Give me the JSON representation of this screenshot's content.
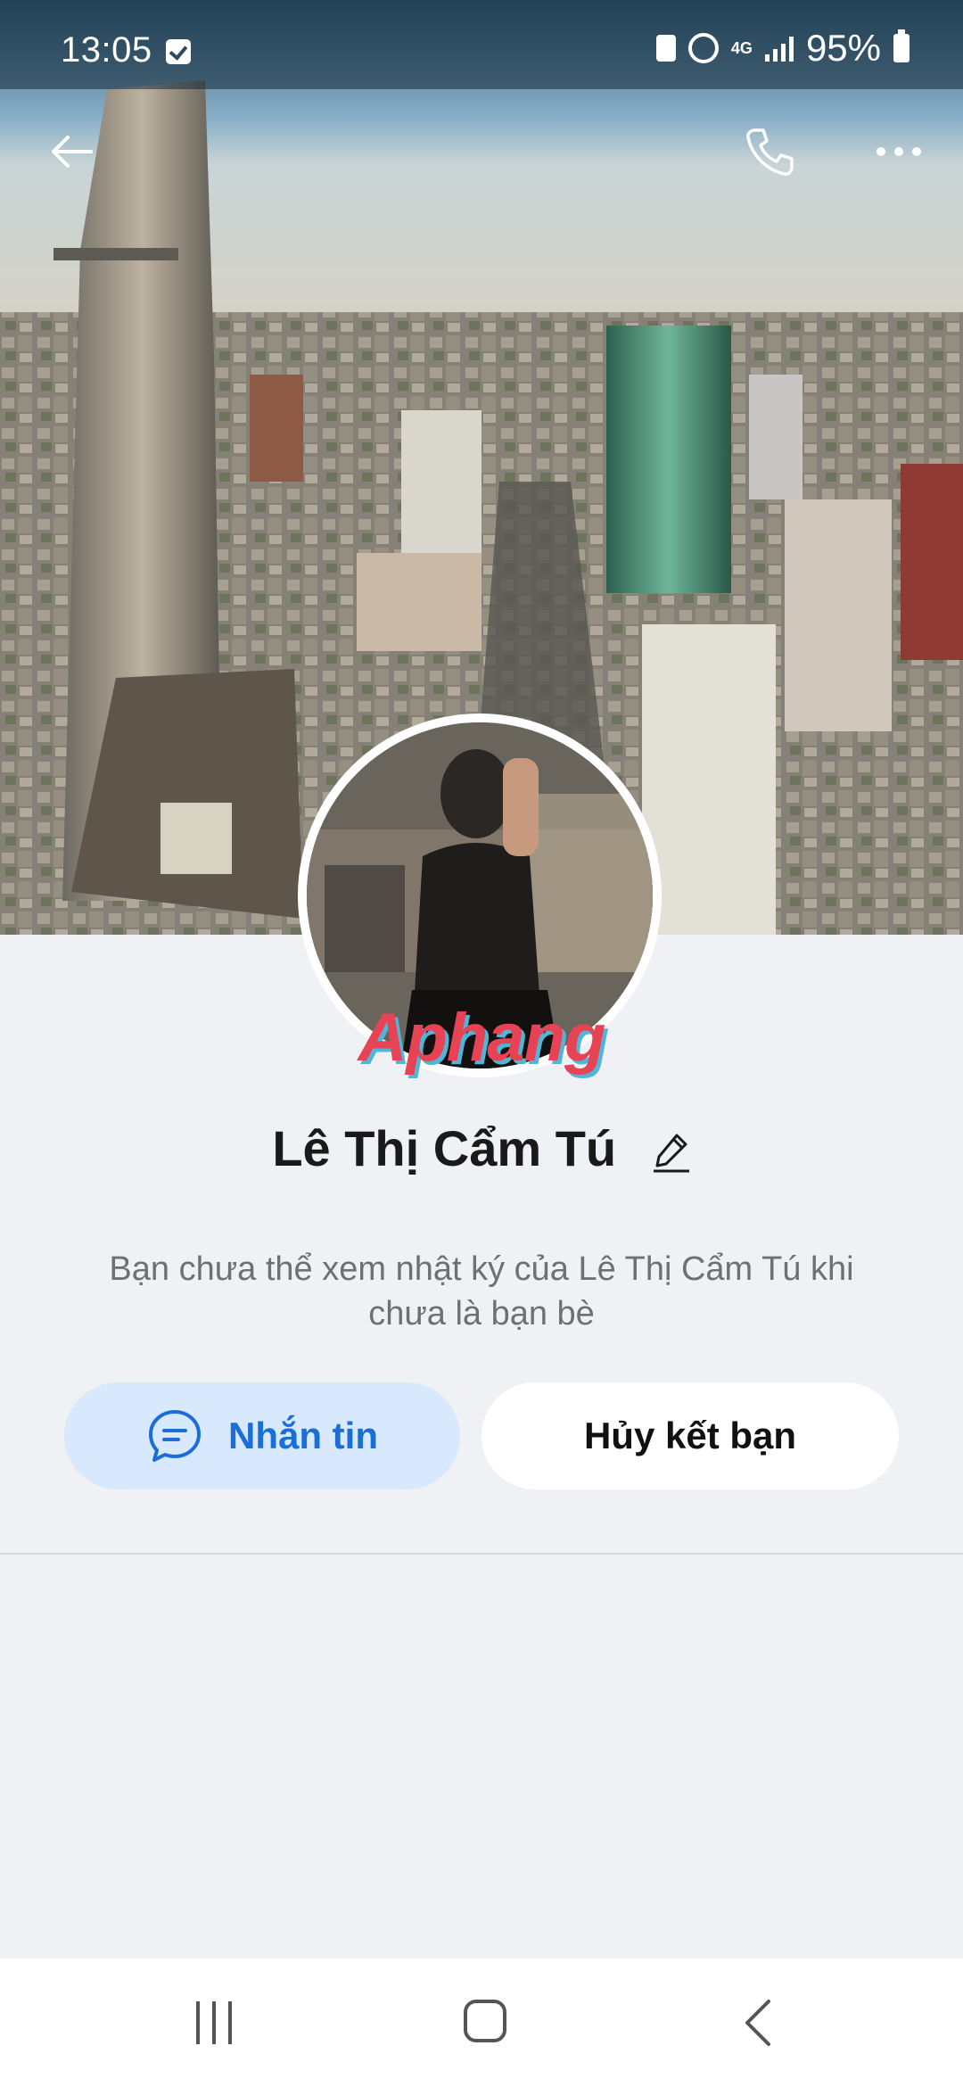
{
  "status_bar": {
    "time": "13:05",
    "network": "4G",
    "battery": "95%",
    "icons": [
      "check-box-icon",
      "gallery-icon",
      "alarm-icon",
      "network-4g-icon",
      "signal-icon",
      "battery-icon"
    ]
  },
  "header": {
    "back_icon": "arrow-left-icon",
    "call_icon": "phone-icon",
    "more_icon": "more-horizontal-icon"
  },
  "cover": {
    "description_colors": {
      "sky": "#7aa2c2",
      "city": "#8a8070"
    }
  },
  "avatar": {
    "watermark_text": "Aphang"
  },
  "profile": {
    "name": "Lê Thị Cẩm Tú",
    "edit_icon": "pencil-icon",
    "info": "Bạn chưa thể xem nhật ký của Lê Thị Cẩm Tú khi chưa là bạn bè"
  },
  "actions": {
    "message_label": "Nhắn tin",
    "message_icon": "chat-bubble-icon",
    "unfriend_label": "Hủy kết bạn"
  },
  "bottom_nav": {
    "recents_icon": "recent-apps-icon",
    "home_icon": "home-icon",
    "back_icon": "back-icon"
  },
  "colors": {
    "accent": "#1a6ed8",
    "accent_bg": "#d8e8fd",
    "page_bg": "#f0f1f5",
    "text_primary": "#1a1a1a",
    "text_secondary": "#6e7074"
  }
}
